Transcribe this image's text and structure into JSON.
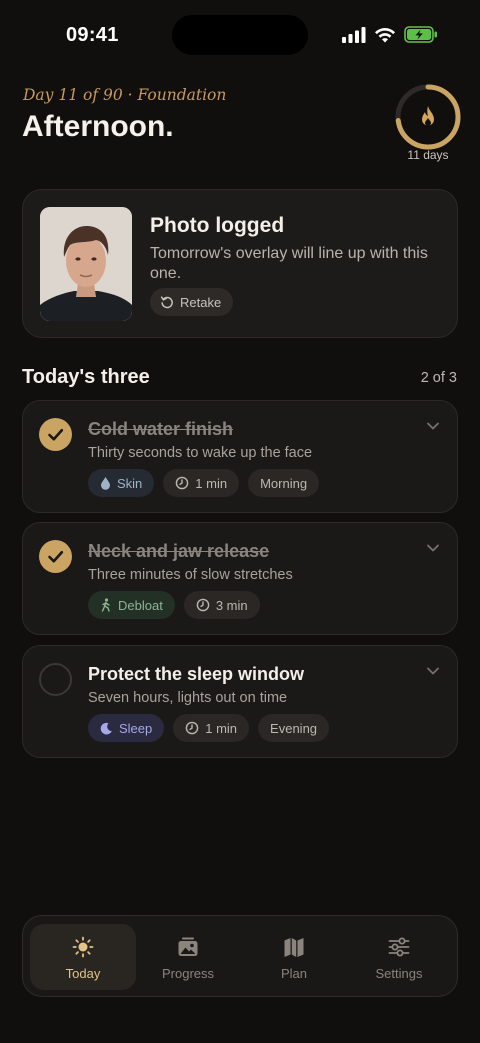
{
  "status_bar": {
    "time": "09:41"
  },
  "header": {
    "subtitle": "Day 11 of 90 · Foundation",
    "title": "Afternoon.",
    "streak_label": "11 days",
    "streak_progress": 0.73,
    "accent": "#c79a5d"
  },
  "photo_card": {
    "title": "Photo logged",
    "description": "Tomorrow's overlay will line up with this one.",
    "retake_label": "Retake"
  },
  "section": {
    "title": "Today's three",
    "count": "2 of 3"
  },
  "tasks": [
    {
      "title": "Cold water finish",
      "description": "Thirty seconds to wake up the face",
      "done": true,
      "chips": [
        {
          "icon": "droplet-icon",
          "label": "Skin"
        },
        {
          "icon": "clock-icon",
          "label": "1 min"
        },
        {
          "label": "Morning"
        }
      ]
    },
    {
      "title": "Neck and jaw release",
      "description": "Three minutes of slow stretches",
      "done": true,
      "chips": [
        {
          "icon": "walking-icon",
          "label": "Debloat"
        },
        {
          "icon": "clock-icon",
          "label": "3 min"
        }
      ]
    },
    {
      "title": "Protect the sleep window",
      "description": "Seven hours, lights out on time",
      "done": false,
      "chips": [
        {
          "icon": "moon-icon",
          "label": "Sleep"
        },
        {
          "icon": "clock-icon",
          "label": "1 min"
        },
        {
          "label": "Evening"
        }
      ]
    }
  ],
  "tab_bar": {
    "items": [
      {
        "icon": "sun-icon",
        "label": "Today",
        "active": true
      },
      {
        "icon": "photo-icon",
        "label": "Progress"
      },
      {
        "icon": "map-icon",
        "label": "Plan"
      },
      {
        "icon": "sliders-icon",
        "label": "Settings"
      }
    ]
  }
}
